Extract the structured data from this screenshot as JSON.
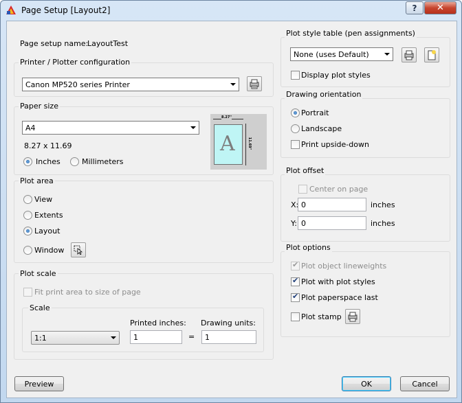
{
  "window": {
    "title": "Page Setup [Layout2]",
    "help": "?",
    "close": "✕"
  },
  "setup_name": {
    "label": "Page setup name:",
    "value": "LayoutTest"
  },
  "printer": {
    "group": "Printer / Plotter configuration",
    "selected": "Canon MP520 series Printer"
  },
  "paper": {
    "group": "Paper size",
    "selected": "A4",
    "dimensions": "8.27 x 11.69",
    "units": [
      {
        "label": "Inches",
        "checked": true
      },
      {
        "label": "Millimeters",
        "checked": false
      }
    ],
    "preview": {
      "letter": "A",
      "width_label": "8.27\"",
      "height_label": "11.69\""
    }
  },
  "plot_area": {
    "group": "Plot area",
    "options": [
      {
        "label": "View",
        "checked": false
      },
      {
        "label": "Extents",
        "checked": false
      },
      {
        "label": "Layout",
        "checked": true
      },
      {
        "label": "Window",
        "checked": false
      }
    ]
  },
  "plot_scale": {
    "group": "Plot scale",
    "fit_label": "Fit print area to size of page",
    "scale_group": "Scale",
    "scale_selected": "1:1",
    "printed_label": "Printed inches:",
    "printed_value": "1",
    "equals": "=",
    "drawing_label": "Drawing units:",
    "drawing_value": "1"
  },
  "plot_style": {
    "group": "Plot style table (pen assignments)",
    "selected": "None (uses Default)",
    "display_label": "Display plot styles"
  },
  "orientation": {
    "group": "Drawing orientation",
    "options": [
      {
        "label": "Portrait",
        "checked": true
      },
      {
        "label": "Landscape",
        "checked": false
      }
    ],
    "upside_down_label": "Print upside-down"
  },
  "plot_offset": {
    "group": "Plot offset",
    "center_label": "Center on page",
    "x_label": "X:",
    "x_value": "0",
    "y_label": "Y:",
    "y_value": "0",
    "unit": "inches"
  },
  "plot_options": {
    "group": "Plot options",
    "items": [
      {
        "label": "Plot object lineweights",
        "checked": true,
        "enabled": false
      },
      {
        "label": "Plot with plot styles",
        "checked": true,
        "enabled": true
      },
      {
        "label": "Plot paperspace last",
        "checked": true,
        "enabled": true
      },
      {
        "label": "Plot stamp",
        "checked": false,
        "enabled": true
      }
    ]
  },
  "buttons": {
    "preview": "Preview",
    "ok": "OK",
    "cancel": "Cancel"
  }
}
